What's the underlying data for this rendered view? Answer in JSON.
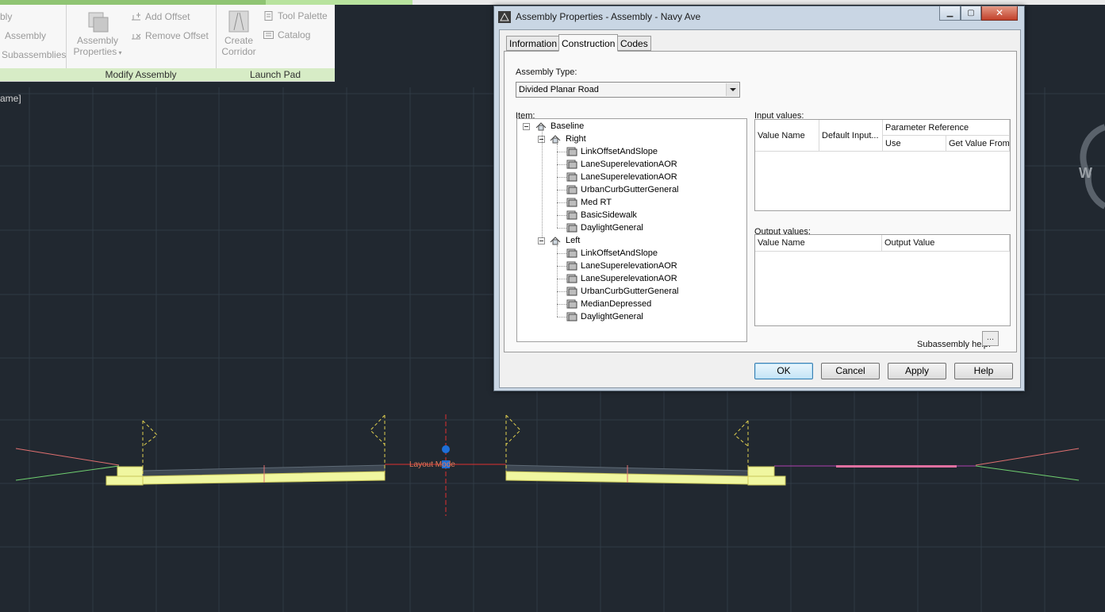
{
  "ribbon": {
    "partial_items": [
      "bly",
      "Assembly",
      "Subassemblies"
    ],
    "modify_panel": {
      "large_button": "Assembly\nProperties",
      "add_offset": "Add Offset",
      "remove_offset": "Remove Offset",
      "title": "Modify Assembly"
    },
    "launch_panel": {
      "large_button": "Create\nCorridor",
      "tool_palette": "Tool Palette",
      "catalog": "Catalog",
      "title": "Launch Pad"
    }
  },
  "viewport": {
    "label": "ame]",
    "viewcube_letter": "W",
    "marker_label": "Layout Mode"
  },
  "dialog": {
    "title": "Assembly Properties - Assembly - Navy Ave",
    "tabs": [
      "Information",
      "Construction",
      "Codes"
    ],
    "active_tab": "Construction",
    "assembly_type_label": "Assembly Type:",
    "assembly_type_value": "Divided Planar Road",
    "item_label": "Item:",
    "tree": {
      "root": "Baseline",
      "groups": [
        {
          "name": "Right",
          "items": [
            "LinkOffsetAndSlope",
            "LaneSuperelevationAOR",
            "LaneSuperelevationAOR",
            "UrbanCurbGutterGeneral",
            "Med RT",
            "BasicSidewalk",
            "DaylightGeneral"
          ]
        },
        {
          "name": "Left",
          "items": [
            "LinkOffsetAndSlope",
            "LaneSuperelevationAOR",
            "LaneSuperelevationAOR",
            "UrbanCurbGutterGeneral",
            "MedianDepressed",
            "DaylightGeneral"
          ]
        }
      ]
    },
    "input_values": {
      "label": "Input values:",
      "col_value_name": "Value Name",
      "col_default_input": "Default Input...",
      "col_param_ref": "Parameter Reference",
      "col_use": "Use",
      "col_get_value_from": "Get Value From"
    },
    "output_values": {
      "label": "Output values:",
      "col_value_name": "Value Name",
      "col_output_value": "Output Value"
    },
    "subassembly_help_label": "Subassembly help:",
    "subassembly_help_button": "...",
    "buttons": {
      "ok": "OK",
      "cancel": "Cancel",
      "apply": "Apply",
      "help": "Help"
    }
  },
  "colors": {
    "canvas_bg": "#212830",
    "grid": "#303a45",
    "ribbon_tab_green": "#8fc473",
    "subassembly_fill": "#f0f7a0",
    "pavement": "#3c4651",
    "marker_blue": "#1e6fd8",
    "median": "#e070a0"
  }
}
